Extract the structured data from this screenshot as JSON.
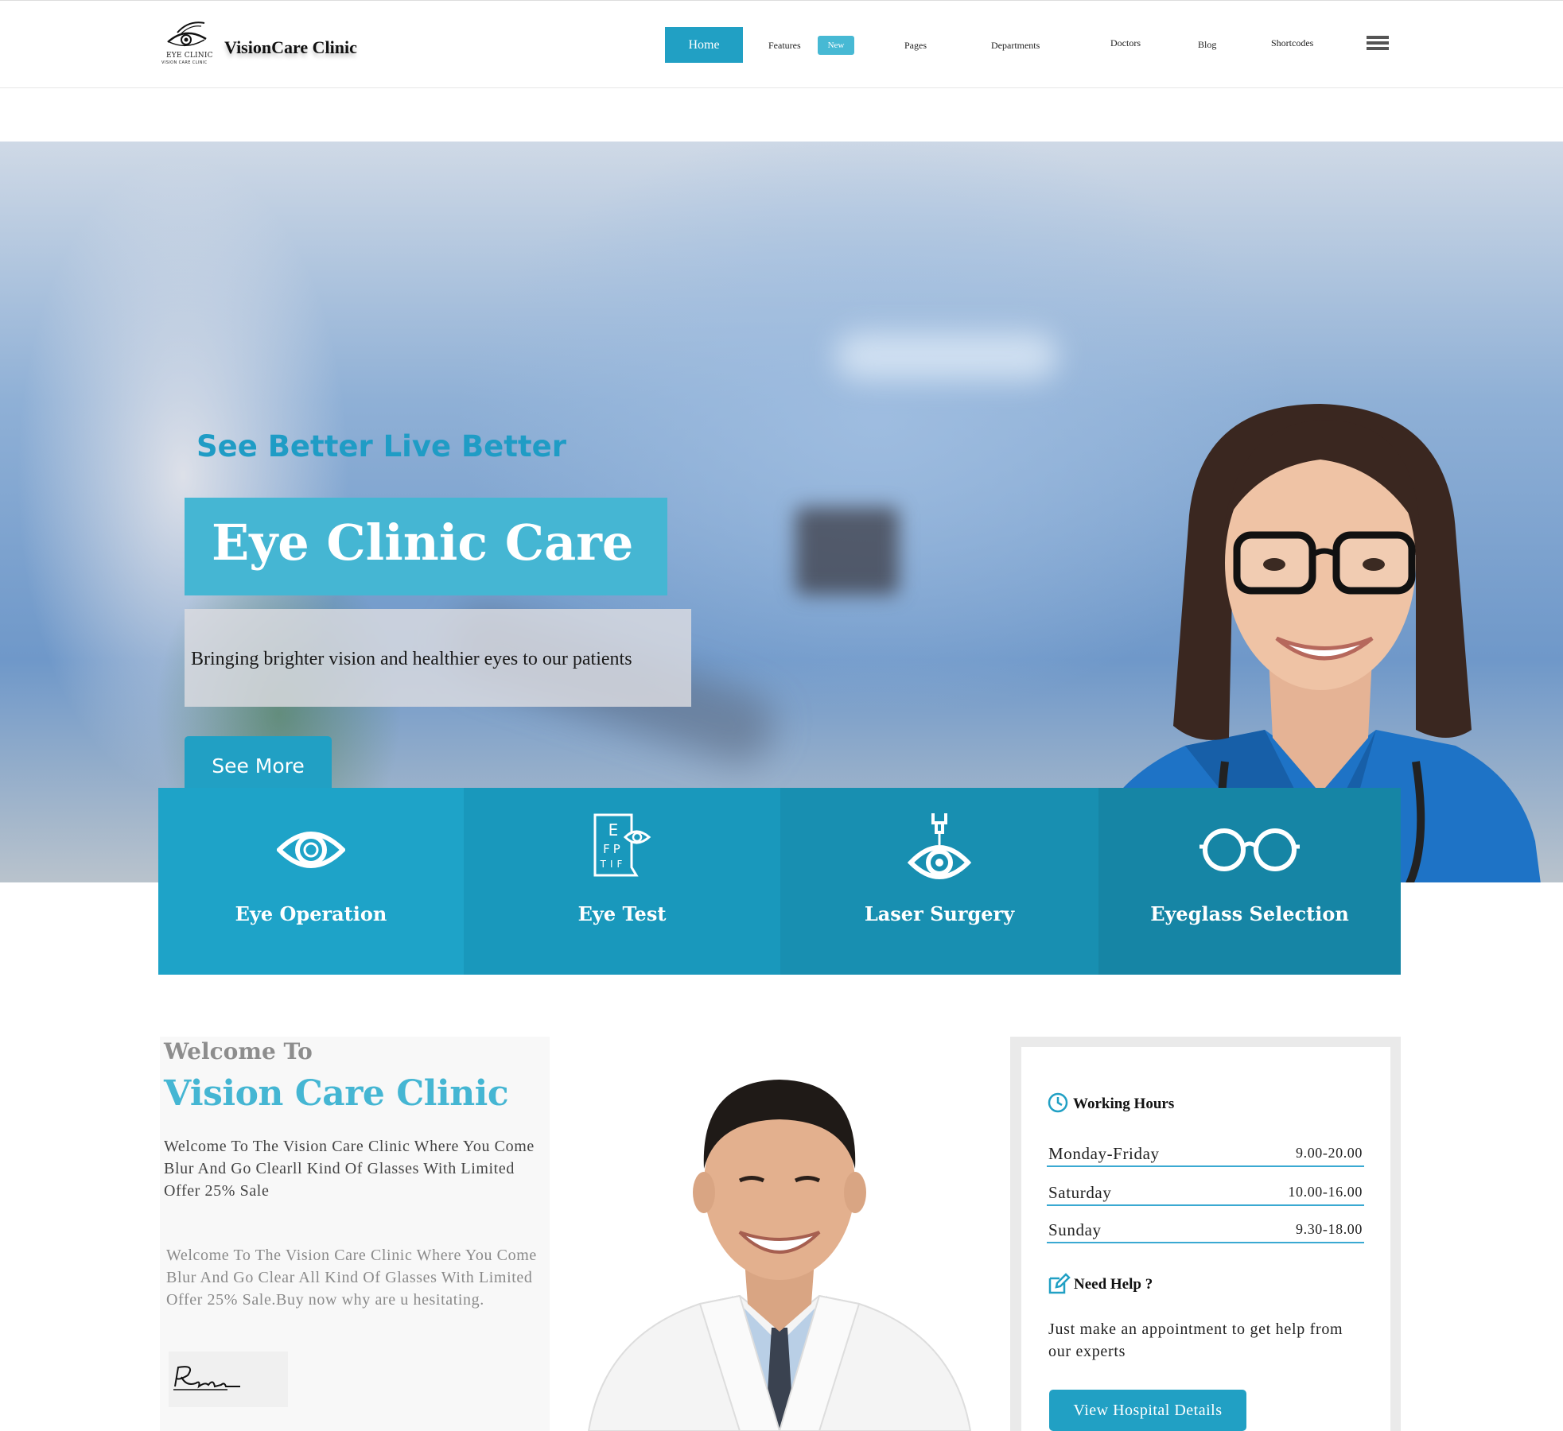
{
  "header": {
    "logo": {
      "line1": "EYE CLINIC",
      "line2": "VISION CARE CLINIC"
    },
    "brand": "VisionCare Clinic",
    "nav": [
      {
        "label": "Home",
        "active": true
      },
      {
        "label": "Features",
        "badge": "New"
      },
      {
        "label": "Pages"
      },
      {
        "label": "Departments"
      },
      {
        "label": "Doctors"
      },
      {
        "label": "Blog"
      },
      {
        "label": "Shortcodes"
      }
    ],
    "menu_icon": "hamburger-icon"
  },
  "hero": {
    "tagline": "See Better Live Better",
    "title": "Eye Clinic Care",
    "subtitle": "Bringing brighter vision and healthier eyes to our patients",
    "cta": "See More"
  },
  "services": [
    {
      "label": "Eye Operation",
      "icon": "eye-icon",
      "color": "#1ea3c8"
    },
    {
      "label": "Eye Test",
      "icon": "eye-chart-icon",
      "color": "#1998bc"
    },
    {
      "label": "Laser Surgery",
      "icon": "laser-eye-icon",
      "color": "#188fb1"
    },
    {
      "label": "Eyeglass Selection",
      "icon": "eyeglasses-icon",
      "color": "#1685a5"
    }
  ],
  "welcome": {
    "heading_small": "Welcome To",
    "heading_large": "Vision Care Clinic",
    "paragraph1": "Welcome To The Vision Care Clinic Where You Come Blur And Go Clearll Kind Of Glasses With Limited Offer 25% Sale",
    "paragraph2": "Welcome To The Vision Care Clinic Where You Come Blur And Go Clear All Kind Of Glasses With Limited Offer 25% Sale.Buy now why are u hesitating."
  },
  "hours": {
    "title": "Working Hours",
    "rows": [
      {
        "day": "Monday-Friday",
        "time": "9.00-20.00"
      },
      {
        "day": "Saturday",
        "time": "10.00-16.00"
      },
      {
        "day": "Sunday",
        "time": "9.30-18.00"
      }
    ],
    "help_title": "Need Help ?",
    "help_text": "Just make an appointment to get help from our experts",
    "button": "View Hospital Details"
  },
  "colors": {
    "accent": "#21a0c4",
    "accent_light": "#45b6d3",
    "badge": "#47b9d4"
  }
}
